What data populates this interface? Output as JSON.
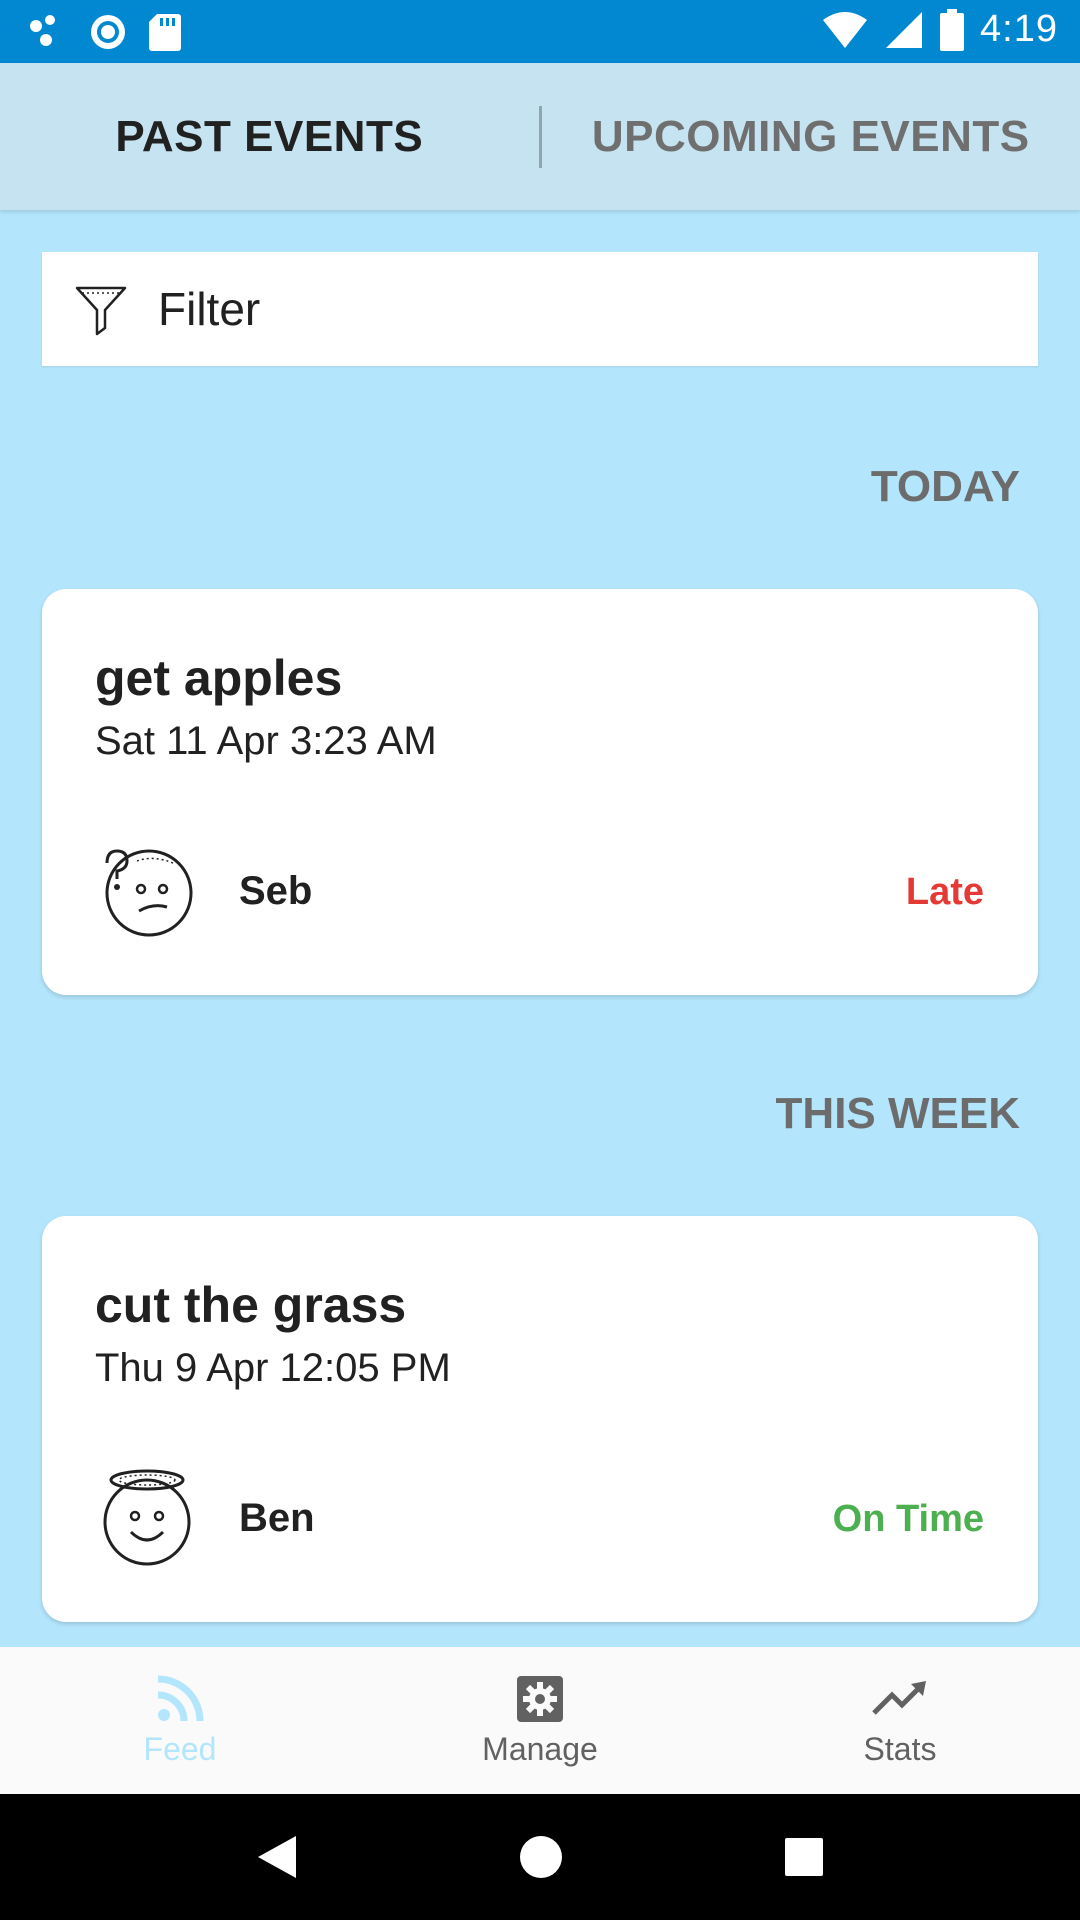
{
  "status_bar": {
    "time": "4:19",
    "icons": [
      "cloud-dots-icon",
      "circle-target-icon",
      "sd-card-icon",
      "wifi-icon",
      "signal-icon",
      "battery-icon"
    ]
  },
  "tabs": [
    {
      "label": "PAST EVENTS",
      "active": true
    },
    {
      "label": "UPCOMING EVENTS",
      "active": false
    }
  ],
  "filter": {
    "label": "Filter",
    "icon": "filter-icon"
  },
  "sections": [
    {
      "heading": "TODAY",
      "event": {
        "title": "get apples",
        "datetime": "Sat 11 Apr 3:23 AM",
        "person": "Seb",
        "avatar_icon": "confused-face-icon",
        "status": "Late",
        "status_color": "#e53935"
      }
    },
    {
      "heading": "THIS WEEK",
      "event": {
        "title": "cut the grass",
        "datetime": "Thu 9 Apr 12:05 PM",
        "person": "Ben",
        "avatar_icon": "angel-face-icon",
        "status": "On Time",
        "status_color": "#4caf50"
      }
    }
  ],
  "bottom_nav": [
    {
      "label": "Feed",
      "icon": "rss-feed-icon",
      "active": true
    },
    {
      "label": "Manage",
      "icon": "gear-icon",
      "active": false
    },
    {
      "label": "Stats",
      "icon": "trending-up-icon",
      "active": false
    }
  ],
  "colors": {
    "status_bar": "#0288d1",
    "background": "#b3e5fc",
    "tab_bar": "#c5e3f0",
    "nav_active": "#b3e5fc",
    "nav_inactive": "#616161"
  }
}
